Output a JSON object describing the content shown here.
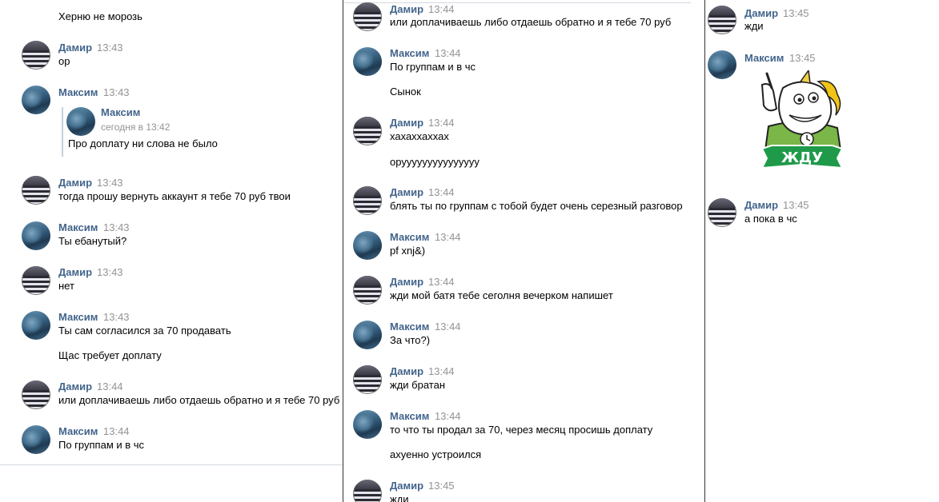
{
  "col1": {
    "top_text": "Херню не морозь",
    "messages": [
      {
        "author": "Дамир",
        "time": "13:43",
        "text": "ор"
      },
      {
        "author": "Максим",
        "time": "13:43",
        "forward": {
          "author": "Максим",
          "date": "сегодня в 13:42",
          "text": "Про доплату ни слова не было"
        }
      },
      {
        "author": "Дамир",
        "time": "13:43",
        "text": "тогда прошу вернуть аккаунт я тебе 70 руб твои"
      },
      {
        "author": "Максим",
        "time": "13:43",
        "text": "Ты ебанутый?"
      },
      {
        "author": "Дамир",
        "time": "13:43",
        "text": "нет"
      },
      {
        "author": "Максим",
        "time": "13:43",
        "text": "Ты сам согласился за 70 продавать",
        "text2": "Щас требует доплату"
      },
      {
        "author": "Дамир",
        "time": "13:44",
        "text": "или доплачиваешь либо отдаешь обратно и я тебе 70 руб"
      },
      {
        "author": "Максим",
        "time": "13:44",
        "text": "По группам и в чс"
      }
    ]
  },
  "col2": {
    "messages": [
      {
        "author": "Дамир",
        "time": "13:44",
        "text": "или доплачиваешь либо отдаешь обратно и я тебе 70 руб"
      },
      {
        "author": "Максим",
        "time": "13:44",
        "text": "По группам и в чс",
        "text2": "Сынок"
      },
      {
        "author": "Дамир",
        "time": "13:44",
        "text": "хахаххаххах",
        "text2": "орууууууууууууууу"
      },
      {
        "author": "Дамир",
        "time": "13:44",
        "text": "блять ты по группам с тобой будет очень серезный разговор"
      },
      {
        "author": "Максим",
        "time": "13:44",
        "text": "pf xnj&)"
      },
      {
        "author": "Дамир",
        "time": "13:44",
        "text": "жди мой батя тебе сеголня вечерком напишет"
      },
      {
        "author": "Максим",
        "time": "13:44",
        "text": "За что?)"
      },
      {
        "author": "Дамир",
        "time": "13:44",
        "text": "жди братан"
      },
      {
        "author": "Максим",
        "time": "13:44",
        "text": "то что ты продал за 70, через месяц просишь доплату",
        "text2": "ахуенно устроился"
      },
      {
        "author": "Дамир",
        "time": "13:45",
        "text": "жди"
      }
    ]
  },
  "col3": {
    "messages": [
      {
        "author": "Дамир",
        "time": "13:45",
        "text": "жди"
      },
      {
        "author": "Максим",
        "time": "13:45",
        "sticker_text": "ЖДУ"
      },
      {
        "author": "Дамир",
        "time": "13:45",
        "text": "а пока в чс"
      }
    ]
  },
  "colors": {
    "name": "#42648b",
    "time": "#939393",
    "sticker_green": "#1f9a4a"
  }
}
